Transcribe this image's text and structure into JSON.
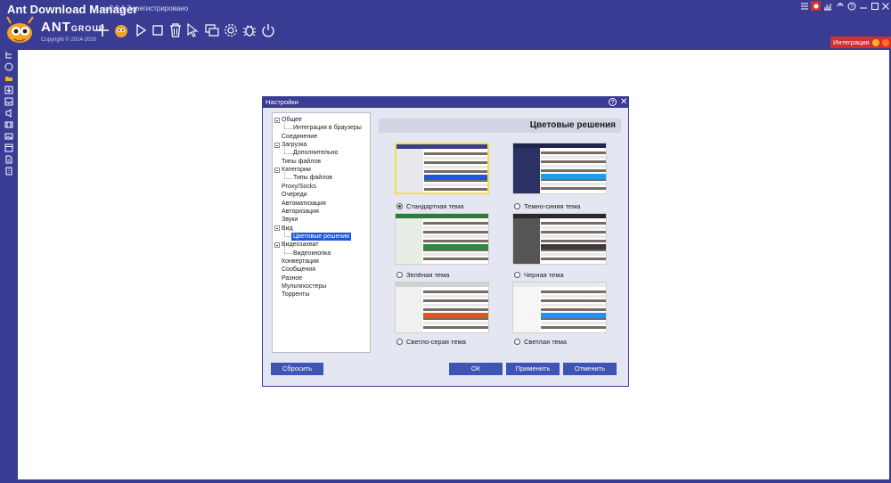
{
  "app": {
    "title": "Ant Download Manager",
    "version_text": "v.2.0.1 Зарегистрировано",
    "logo_text": "ANT",
    "logo_sub": "GROUP",
    "copyright": "Copyright © 2014-2020",
    "integration_label": "Интеграция"
  },
  "toolbar": {
    "icons": [
      "add-icon",
      "ant-badge-icon",
      "play-icon",
      "stop-icon",
      "delete-icon",
      "cursor-icon",
      "windows-icon",
      "gear-icon",
      "bug-icon",
      "power-icon"
    ]
  },
  "sidebar": {
    "icons": [
      "tree-icon",
      "help-circle-icon",
      "folder-icon",
      "download-arrow-icon",
      "inbox-icon",
      "music-icon",
      "film-icon",
      "image-icon",
      "window-icon",
      "document-icon",
      "archive-icon"
    ]
  },
  "dialog": {
    "title": "Настройки",
    "section_title": "Цветовые решения",
    "tree": [
      {
        "label": "Общее",
        "level": 0
      },
      {
        "label": "Интеграция в браузеры",
        "level": 1
      },
      {
        "label": "Соединение",
        "level": 0
      },
      {
        "label": "Загрузка",
        "level": 0
      },
      {
        "label": "Дополнительно",
        "level": 1
      },
      {
        "label": "Типы файлов",
        "level": 0
      },
      {
        "label": "Категории",
        "level": 0
      },
      {
        "label": "Типы файлов",
        "level": 1
      },
      {
        "label": "Proxy/Socks",
        "level": 0
      },
      {
        "label": "Очереди",
        "level": 0
      },
      {
        "label": "Автоматизация",
        "level": 0
      },
      {
        "label": "Авторизация",
        "level": 0
      },
      {
        "label": "Звуки",
        "level": 0
      },
      {
        "label": "Вид",
        "level": 0
      },
      {
        "label": "Цветовые решения",
        "level": 1
      },
      {
        "label": "Видеозахват",
        "level": 0
      },
      {
        "label": "Видеокнопка",
        "level": 1
      },
      {
        "label": "Конвертация",
        "level": 0
      },
      {
        "label": "Сообщения",
        "level": 0
      },
      {
        "label": "Разное",
        "level": 0
      },
      {
        "label": "Мультихостеры",
        "level": 0
      },
      {
        "label": "Торренты",
        "level": 0
      }
    ],
    "selected_tree_item": "Цветовые решения",
    "themes": [
      {
        "label": "Стандартная тема",
        "selected": true,
        "bar": "#3a3b93",
        "side": "#e8e8ee",
        "hl": "#1f57d8"
      },
      {
        "label": "Темно-синяя тема",
        "selected": false,
        "bar": "#20254f",
        "side": "#2b3163",
        "hl": "#1f9fe6"
      },
      {
        "label": "Зелёная тема",
        "selected": false,
        "bar": "#2f7a3b",
        "side": "#e6eee6",
        "hl": "#2f8a3f"
      },
      {
        "label": "Черная тема",
        "selected": false,
        "bar": "#2a2a2a",
        "side": "#555555",
        "hl": "#3a3a3a"
      },
      {
        "label": "Светло-серая тема",
        "selected": false,
        "bar": "#d0d0d0",
        "side": "#f0f0f0",
        "hl": "#e0561f"
      },
      {
        "label": "Светлая тема",
        "selected": false,
        "bar": "#e8e8e8",
        "side": "#f6f6f6",
        "hl": "#1e90ff"
      }
    ],
    "buttons": {
      "reset": "Сбросить",
      "ok": "ОК",
      "apply": "Применить",
      "cancel": "Отменить"
    }
  }
}
